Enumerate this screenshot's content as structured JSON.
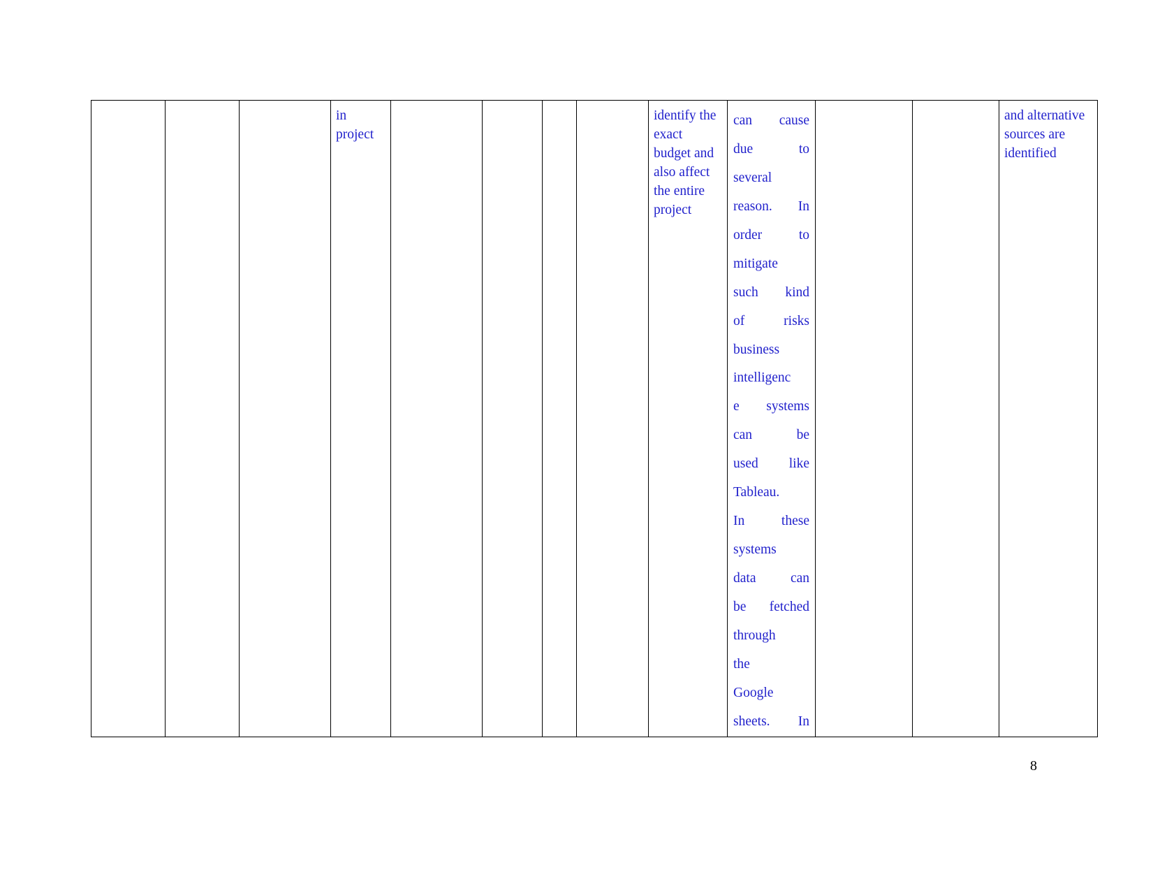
{
  "document": {
    "page_number": "8",
    "text_color": "#2222cc",
    "border_color": "#000000",
    "background_color": "#ffffff"
  },
  "table": {
    "columns": 13,
    "row": {
      "cells": [
        {
          "index": 0,
          "text": "",
          "align": "left"
        },
        {
          "index": 1,
          "text": "",
          "align": "left"
        },
        {
          "index": 2,
          "text": "",
          "align": "left"
        },
        {
          "index": 3,
          "text": "in project",
          "align": "left"
        },
        {
          "index": 4,
          "text": "",
          "align": "left"
        },
        {
          "index": 5,
          "text": "",
          "align": "left"
        },
        {
          "index": 6,
          "text": "",
          "align": "left"
        },
        {
          "index": 7,
          "text": "",
          "align": "left"
        },
        {
          "index": 8,
          "text": "identify the exact budget and also affect the entire project",
          "align": "left"
        },
        {
          "index": 9,
          "text": "can cause due to several reason. In order to mitigate such kind of risks business intelligence systems can be used like Tableau. In these systems data can be fetched through the Google sheets. In",
          "align": "justify"
        },
        {
          "index": 10,
          "text": "",
          "align": "left"
        },
        {
          "index": 11,
          "text": "",
          "align": "left"
        },
        {
          "index": 12,
          "text": "and alternative sources are identified",
          "align": "left"
        }
      ]
    },
    "justified_cell_lines": [
      [
        "can",
        "cause"
      ],
      [
        "due",
        "to"
      ],
      [
        "several"
      ],
      [
        "reason.",
        "In"
      ],
      [
        "order",
        "to"
      ],
      [
        "mitigate"
      ],
      [
        "such",
        "kind"
      ],
      [
        "of",
        "risks"
      ],
      [
        "business"
      ],
      [
        "intelligenc"
      ],
      [
        "e",
        "systems"
      ],
      [
        "can",
        "be"
      ],
      [
        "used",
        "like"
      ],
      [
        "Tableau."
      ],
      [
        "In",
        "these"
      ],
      [
        "systems"
      ],
      [
        "data",
        "can"
      ],
      [
        "be",
        "fetched"
      ],
      [
        "through"
      ],
      [
        "the"
      ],
      [
        "Google"
      ],
      [
        "sheets.",
        "In"
      ]
    ]
  }
}
